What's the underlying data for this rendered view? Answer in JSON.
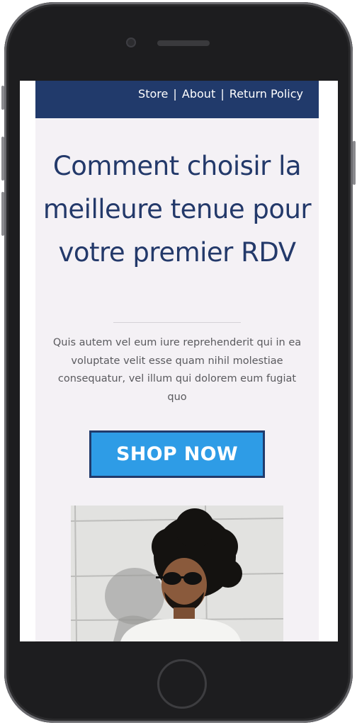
{
  "nav": {
    "links": [
      "Store",
      "About",
      "Return Policy"
    ],
    "separator": "|"
  },
  "hero": {
    "headline": "Comment choisir la meilleure tenue pour votre premier RDV",
    "body": "Quis autem vel eum iure reprehenderit qui in ea voluptate velit esse quam nihil molestiae consequatur, vel illum qui dolorem eum fugiat quo",
    "cta_label": "SHOP NOW"
  },
  "colors": {
    "navbar": "#213a6b",
    "headline": "#23396a",
    "cta_fill": "#2e9ce6",
    "cta_border": "#213a6b",
    "page_bg": "#f4f1f5"
  },
  "image": {
    "subject": "man with curly hair and sunglasses in white t-shirt against tiled wall"
  }
}
